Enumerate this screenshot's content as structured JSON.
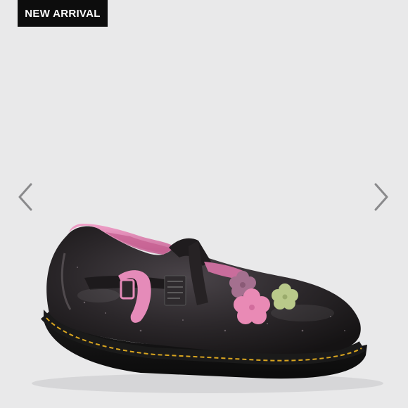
{
  "badge": {
    "label": "NEW ARRIVAL"
  },
  "carousel": {
    "prev_icon": "chevron-left-icon",
    "next_icon": "chevron-right-icon"
  },
  "colors": {
    "background": "#e9e9ea",
    "badge_bg": "#0d0d0d",
    "badge_text": "#ffffff",
    "chevron": "#8a8a8c",
    "shoe_patent": "#2a2629",
    "lining_pink": "#e58bb9",
    "welt_stitch": "#d9a51f",
    "flower_pink": "#e98ab5",
    "flower_green": "#b9c98a"
  }
}
